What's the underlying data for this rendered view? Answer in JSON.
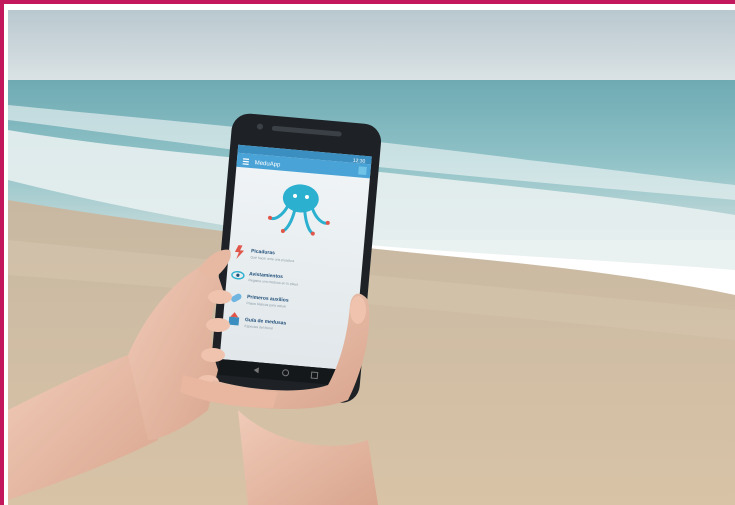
{
  "app": {
    "title": "MeduApp",
    "status_time": "12:30",
    "menu": [
      {
        "label": "Picaduras",
        "sub": "Qué hacer ante una picadura",
        "icon": "lightning-icon"
      },
      {
        "label": "Avistamientos",
        "sub": "Registra una medusa en tu playa",
        "icon": "eye-icon"
      },
      {
        "label": "Primeros auxilios",
        "sub": "Pasos básicos para actuar",
        "icon": "bandage-icon"
      },
      {
        "label": "Guía de medusas",
        "sub": "Especies del litoral",
        "icon": "book-icon"
      }
    ]
  },
  "colors": {
    "frame": "#c2185b",
    "app_bar": "#4aa3d6",
    "screen_bg": "#eaf0f3",
    "logo": "#2bb0cf",
    "logo_dots": "#e0564a"
  }
}
